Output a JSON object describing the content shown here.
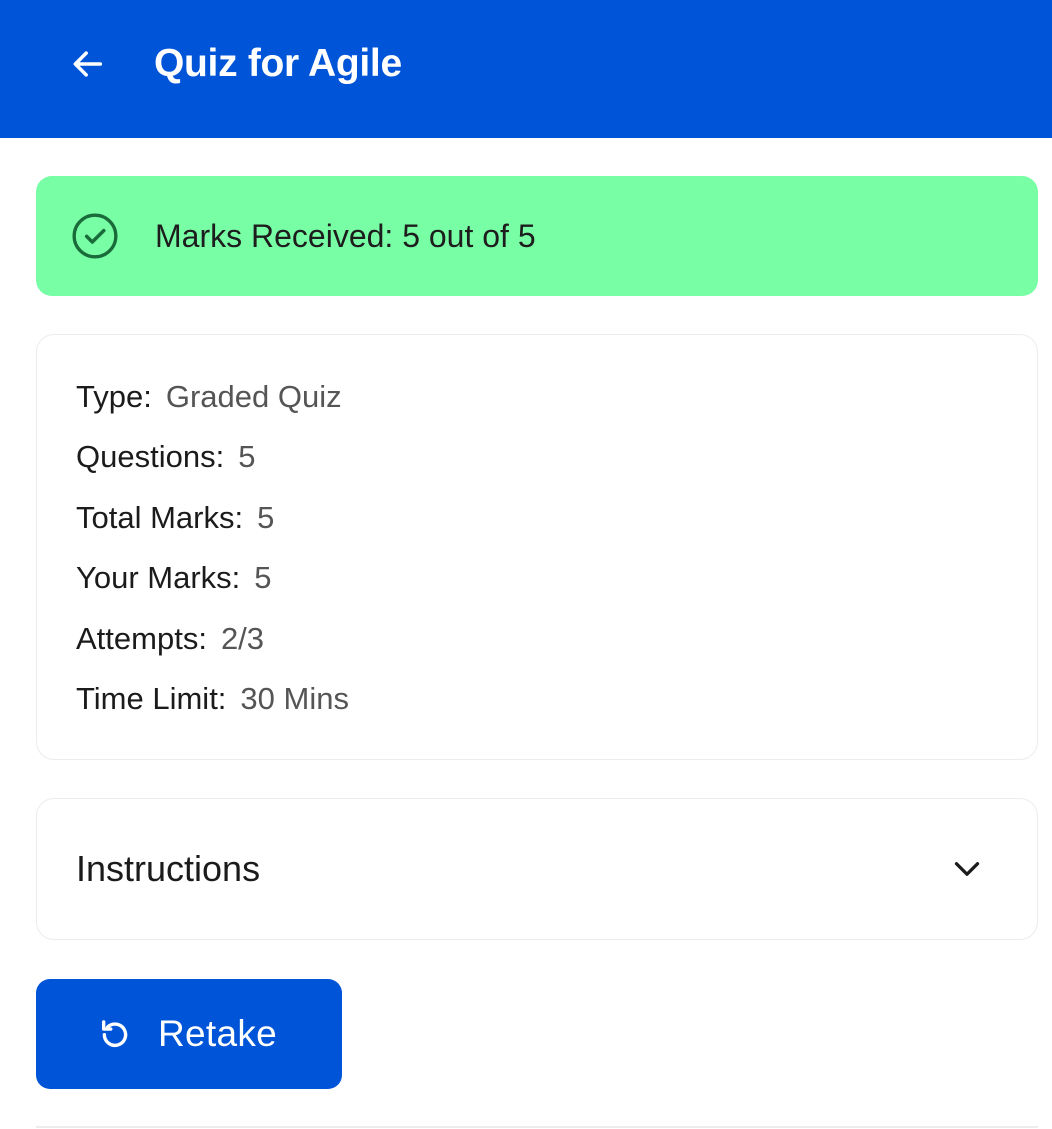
{
  "app_bar": {
    "title": "Quiz for Agile",
    "back_icon": "arrow-left-icon",
    "background_color": "#0054d8"
  },
  "result_banner": {
    "icon": "check-circle-icon",
    "text": "Marks Received: 5 out of 5",
    "background_color": "#78ffa6"
  },
  "details": [
    {
      "label": "Type:",
      "value": "Graded Quiz"
    },
    {
      "label": "Questions:",
      "value": "5"
    },
    {
      "label": "Total Marks:",
      "value": "5"
    },
    {
      "label": "Your Marks:",
      "value": "5"
    },
    {
      "label": "Attempts:",
      "value": "2/3"
    },
    {
      "label": "Time Limit:",
      "value": "30 Mins"
    }
  ],
  "instructions": {
    "label": "Instructions",
    "icon": "chevron-down-icon"
  },
  "retake_button": {
    "label": "Retake",
    "icon": "retake-icon",
    "background_color": "#0054d8"
  }
}
